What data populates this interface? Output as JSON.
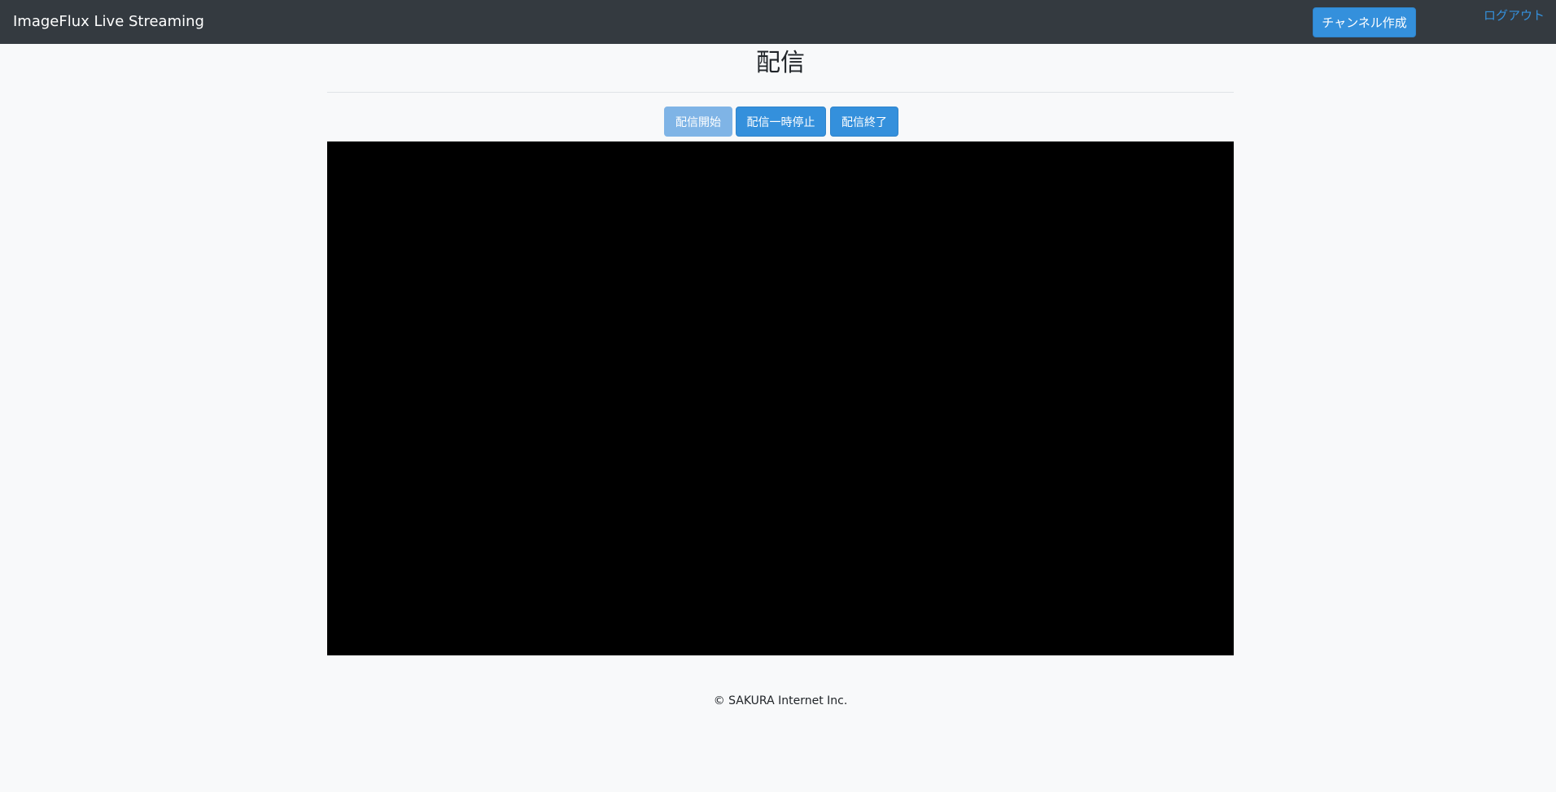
{
  "navbar": {
    "brand": "ImageFlux Live Streaming",
    "create_channel_label": "チャンネル作成",
    "logout_label": "ログアウト"
  },
  "main": {
    "title": "配信",
    "controls": {
      "start_label": "配信開始",
      "pause_label": "配信一時停止",
      "end_label": "配信終了"
    }
  },
  "footer": {
    "copyright": "© SAKURA Internet Inc."
  },
  "colors": {
    "navbar_bg": "#343a40",
    "primary": "#3490dc",
    "primary_disabled": "#7fb4e6",
    "page_bg": "#f8f9fa",
    "video_bg": "#000000"
  }
}
